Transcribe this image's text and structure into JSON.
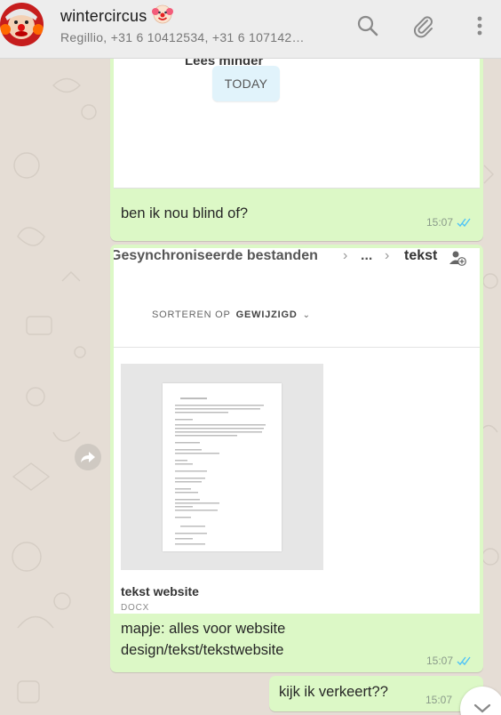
{
  "header": {
    "name": "wintercircus",
    "emoji": "🤡",
    "subtitle": "Regillio, +31 6 10412534, +31 6 107142…",
    "icons": [
      "search-icon",
      "attach-icon",
      "menu-icon"
    ]
  },
  "messages": {
    "first": {
      "shot_text": "Lees minder",
      "today_label": "TODAY",
      "caption": "ben ik nou blind of?",
      "time": "15:07"
    },
    "second": {
      "breadcrumb_left": "Gesynchroniseerde bestanden",
      "breadcrumb_dots": "...",
      "breadcrumb_right": "tekst",
      "sort_label": "SORTEREN OP",
      "sort_value": "GEWIJZIGD",
      "file_name": "tekst website",
      "file_type": "DOCX",
      "caption_line1": "mapje: alles voor website",
      "caption_line2": "design/tekst/tekstwebsite",
      "time": "15:07"
    },
    "third": {
      "caption": "kijk ik verkeert??",
      "time": "15:07"
    }
  },
  "colors": {
    "outgoing_bubble": "#dcf8c6",
    "header_bg": "#ededed",
    "chat_bg": "#e5ddd5",
    "read_ticks": "#4fc3f7"
  }
}
